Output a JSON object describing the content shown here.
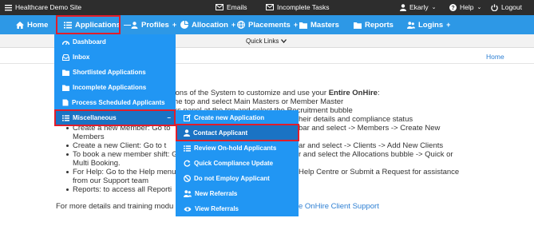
{
  "topbar": {
    "site": "Healthcare Demo Site",
    "emails": "Emails",
    "incomplete_tasks": "Incomplete Tasks",
    "user": "Ekarly",
    "help": "Help",
    "logout": "Logout"
  },
  "nav": {
    "home": "Home",
    "applications": "Applications",
    "profiles": "Profiles",
    "allocation": "Allocation",
    "placements": "Placements",
    "masters": "Masters",
    "reports": "Reports",
    "logins": "Logins"
  },
  "quick_links": "Quick Links",
  "breadcrumb": "Home",
  "applications_menu": [
    "Dashboard",
    "Inbox",
    "Shortlisted Applications",
    "Incomplete Applications",
    "Process Scheduled Applicants",
    "Miscellaneous"
  ],
  "misc_menu": [
    "Create new Application",
    "Contact Applicant",
    "Review On-hold Applicants",
    "Quick Compliance Update",
    "Do not Employ Applicant",
    "New Referrals",
    "View Referrals"
  ],
  "body": {
    "l1": "ctions of the System to customize and use your ",
    "l1b": "Entire OnHire",
    "l1c": ":",
    "l2": "t the top and select Main Masters or Member Master",
    "l3": "inks panel at the top and select the Recruitment bubble",
    "l4": "heir details and compliance status",
    "l5a": "Create a new Member: Go to",
    "l5b": "bar and select -> Members -> Create New",
    "l6": "Members",
    "l7a": "Create a new Client: Go to t",
    "l7b": "ar and select -> Clients -> Add New Clients",
    "l8a": "To book a new member shift: G",
    "l8b": "r and select the Allocations bubble -> Quick or",
    "l9": "Multi Booking.",
    "l10a": "For Help: Go to the Help menu",
    "l10b": "Help Centre or Submit a Request for assistance",
    "l11": "from our Support team",
    "l12": "Reports: to access all Reporti",
    "l13a": "For more details and training modu",
    "l13b": "e OnHire Client Support"
  },
  "colors": {
    "topbar": "#2d2d2d",
    "nav": "#2d98e6",
    "menu": "#2196f3",
    "highlight": "#e11d2b",
    "link": "#2d7fd3"
  }
}
